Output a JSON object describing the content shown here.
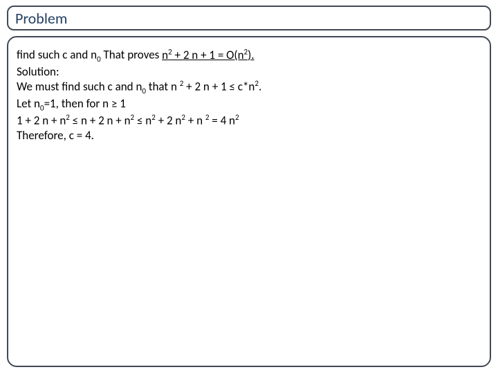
{
  "title": "Problem",
  "line1_a": "find such c and n",
  "line1_b": " That proves ",
  "line1_c": "n",
  "line1_d": " + 2 n + 1 = O(n",
  "line1_e": ").",
  "line2": "Solution:",
  "line3_a": "We must find such c and n",
  "line3_b": " that n ",
  "line3_c": " + 2 n + 1 ≤ c*n",
  "line3_d": ".",
  "line4_a": "Let n",
  "line4_b": "=1, then for n ≥ 1",
  "line5_a": "1 + 2 n + n",
  "line5_b": " ≤ n + 2 n + n",
  "line5_c": " ≤ n",
  "line5_d": " + 2 n",
  "line5_e": " + n ",
  "line5_f": " = 4 n",
  "line6": "Therefore, c = 4.",
  "sub0": "0",
  "sup2": "2"
}
